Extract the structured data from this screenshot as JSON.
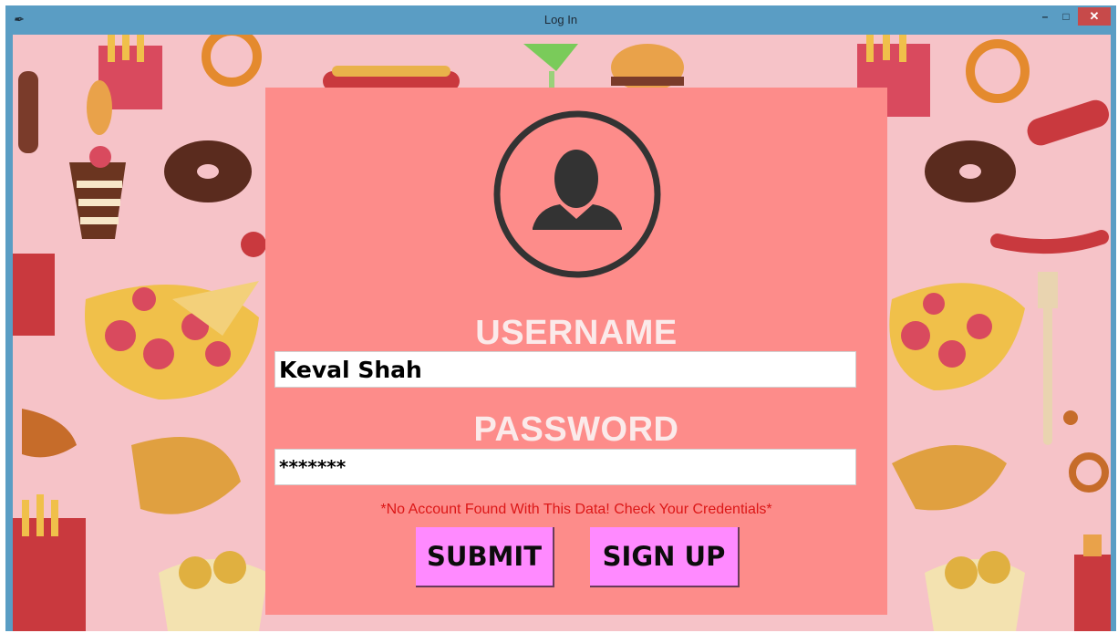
{
  "window": {
    "title": "Log In",
    "app_icon": "feather-icon",
    "minimize_glyph": "–",
    "maximize_glyph": "□",
    "close_glyph": "✕"
  },
  "login": {
    "avatar_icon": "user-avatar-icon",
    "username_label": "USERNAME",
    "username_value": "Keval Shah",
    "password_label": "PASSWORD",
    "password_value": "*******",
    "error_message": "*No Account Found With This Data! Check Your Credentials*",
    "submit_label": "SUBMIT",
    "signup_label": "SIGN UP"
  },
  "colors": {
    "titlebar": "#5a9dc4",
    "background": "#f6c3c8",
    "panel": "#fd8c8a",
    "label": "#fbeaea",
    "error": "#dc1717",
    "button": "#ff8aff",
    "avatar": "#333333"
  }
}
